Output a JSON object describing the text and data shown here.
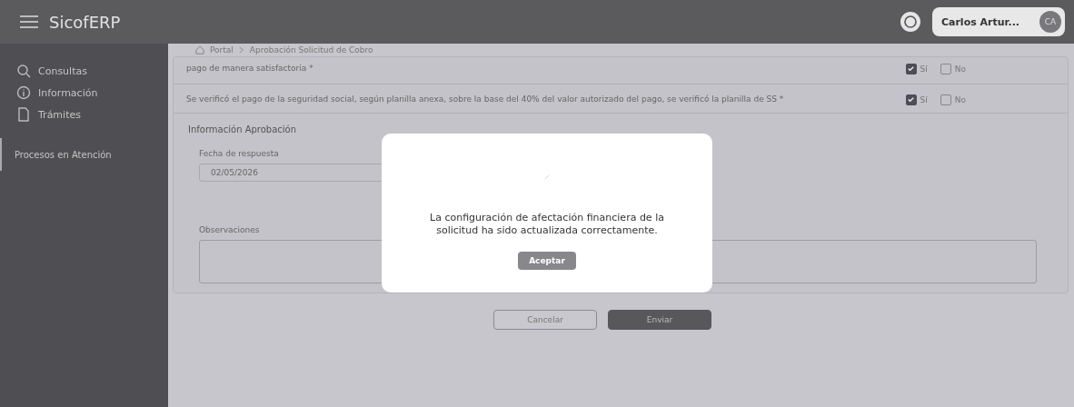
{
  "header": {
    "app_name": "SicofERP",
    "user_name": "Carlos Artur...",
    "user_initials": "CA"
  },
  "sidebar": {
    "items": [
      {
        "label": "Consultas",
        "selected": false
      },
      {
        "label": "Información",
        "selected": false
      },
      {
        "label": "Trámites",
        "selected": false
      },
      {
        "label": "Procesos en Atención",
        "selected": true
      }
    ]
  },
  "breadcrumb": [
    "Portal",
    "Aprobación Solicitud de Cobro"
  ],
  "questions": [
    {
      "text": "pago de manera satisfactoria *",
      "yes_label": "Sí",
      "no_label": "No",
      "yes_checked": true,
      "no_checked": false
    },
    {
      "text": "Se verificó el pago de la seguridad social, según planilla anexa, sobre la base del 40% del valor autorizado del pago, se verificó la planilla de SS *",
      "yes_label": "Sí",
      "no_label": "No",
      "yes_checked": true,
      "no_checked": false
    }
  ],
  "approval": {
    "title": "Información Aprobación",
    "date_label": "Fecha de respuesta",
    "date_value": "02/05/2026",
    "observations_label": "Observaciones"
  },
  "buttons": {
    "cancel": "Cancelar",
    "submit": "Enviar"
  },
  "dialog": {
    "message": "La configuración de afectación financiera de la solicitud ha sido actualizada correctamente.",
    "button": "Aceptar"
  }
}
